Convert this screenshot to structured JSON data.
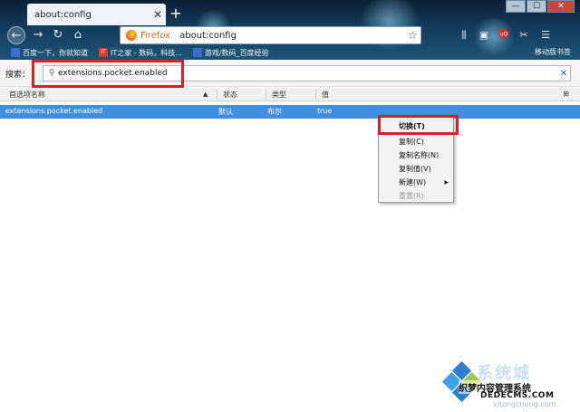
{
  "browser": {
    "tab_title": "about:config",
    "tab_close": "✕",
    "new_tab": "+",
    "window_controls": [
      "—",
      "☐",
      "✕"
    ],
    "url_brand": "Firefox",
    "url": "about:config",
    "bookmarks": [
      {
        "label": "百度一下，你就知道",
        "icon_color": "#3a6ed6"
      },
      {
        "label": "IT之家 - 数码，科技...",
        "icon_color": "#d83a2a"
      },
      {
        "label": "游戏/数码_百度经验",
        "icon_color": "#3a6ed6"
      }
    ],
    "mobile_bookmarks": "移动版书签"
  },
  "config": {
    "search_label": "搜索：",
    "search_value": "extensions.pocket.enabled",
    "columns": [
      "首选项名称",
      "状态",
      "类型",
      "值"
    ],
    "rows": [
      {
        "name": "extensions.pocket.enabled",
        "status": "默认",
        "type": "布尔",
        "value": "true"
      }
    ]
  },
  "context_menu": {
    "items": [
      {
        "label": "切换(T)",
        "enabled": true
      },
      {
        "label": "复制(C)",
        "enabled": true
      },
      {
        "label": "复制名称(N)",
        "enabled": true
      },
      {
        "label": "复制值(V)",
        "enabled": true
      },
      {
        "label": "新建(W)",
        "enabled": true,
        "submenu": true
      },
      {
        "label": "重置(R)",
        "enabled": false
      }
    ]
  },
  "watermark": {
    "text_big": "系统城",
    "text_cn": "织梦内容管理系统",
    "text_en": "DEDECMS.COM",
    "text_sub": "xitongcheng.com"
  },
  "colors": {
    "selection": "#3f8fde",
    "highlight_box": "#d4212a",
    "firefox_label": "#d36a1a"
  }
}
